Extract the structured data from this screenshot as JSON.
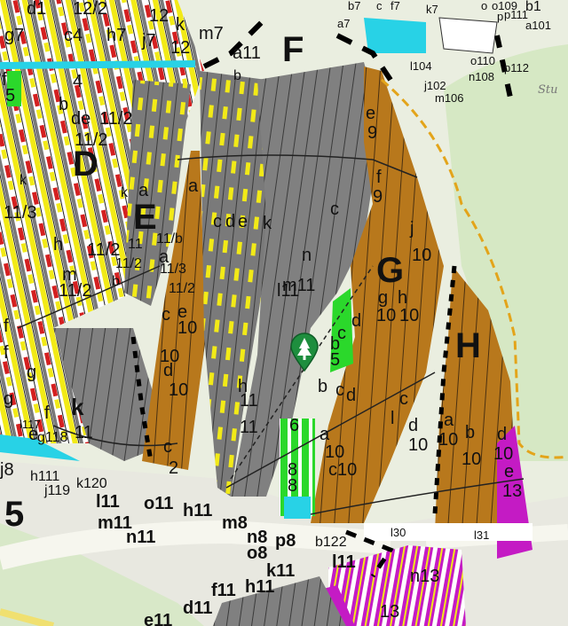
{
  "map": {
    "background_color": "#eaeee0",
    "colors": {
      "forest_gray": "#7a7a7a",
      "forest_brown": "#b8781c",
      "yellow_stripe": "#f2ea17",
      "red_stripe": "#d42020",
      "green_patch": "#2bd82b",
      "cyan_patch": "#28d2e6",
      "magenta_patch": "#c41bc4",
      "road": "#f6f6ee",
      "meadow": "#d6e8c4",
      "boundary_orange": "#e3a41a"
    },
    "compartments": [
      "D",
      "E",
      "F",
      "G",
      "H"
    ],
    "number_5": "5",
    "place_name_fragment": "Stu",
    "labels": [
      "d1",
      "12/2",
      "12",
      "g7",
      "c4",
      "h7",
      "j7",
      "k",
      "12",
      "m7",
      "a11",
      "b",
      "b7",
      "c",
      "f7",
      "k7",
      "o",
      "p",
      "o109",
      "p111",
      "b1",
      "a101",
      "a7",
      "l104",
      "j102",
      "m106",
      "n108",
      "o110",
      "p112",
      "f",
      "4",
      "5",
      "b",
      "de",
      "11/2",
      "11/2",
      "k",
      "a",
      "k",
      "11/3",
      "11/2",
      "h",
      "11/2",
      "m",
      "f",
      "g",
      "11/2",
      "b",
      "11",
      "a",
      "11/b",
      "11/3",
      "11/2",
      "a",
      "c",
      "e",
      "10",
      "10",
      "d",
      "10",
      "h",
      "11",
      "c",
      "d",
      "e",
      "k",
      "f",
      "g",
      "e",
      "f",
      "l117",
      "g118",
      "h111",
      "j119",
      "k120",
      "k",
      "11",
      "j8",
      "l11",
      "m11",
      "n11",
      "o11",
      "h11",
      "c",
      "2",
      "e",
      "9",
      "f",
      "9",
      "j",
      "10",
      "G",
      "c",
      "n",
      "11",
      "m11",
      "l11",
      "11",
      "g",
      "h",
      "10",
      "10",
      "d",
      "c",
      "b",
      "5",
      "b",
      "c",
      "d",
      "a",
      "10",
      "c",
      "d",
      "l",
      "10",
      "c10",
      "a",
      "10",
      "b",
      "10",
      "d",
      "10",
      "e",
      "13",
      "6",
      "8",
      "8",
      "m8",
      "n8",
      "o8",
      "p8",
      "b122",
      "l30",
      "l31",
      "k11",
      "l11",
      "f11",
      "h11",
      "d11",
      "e11",
      "n13",
      "13"
    ],
    "pin_icon": "map-pin-tree-icon"
  }
}
